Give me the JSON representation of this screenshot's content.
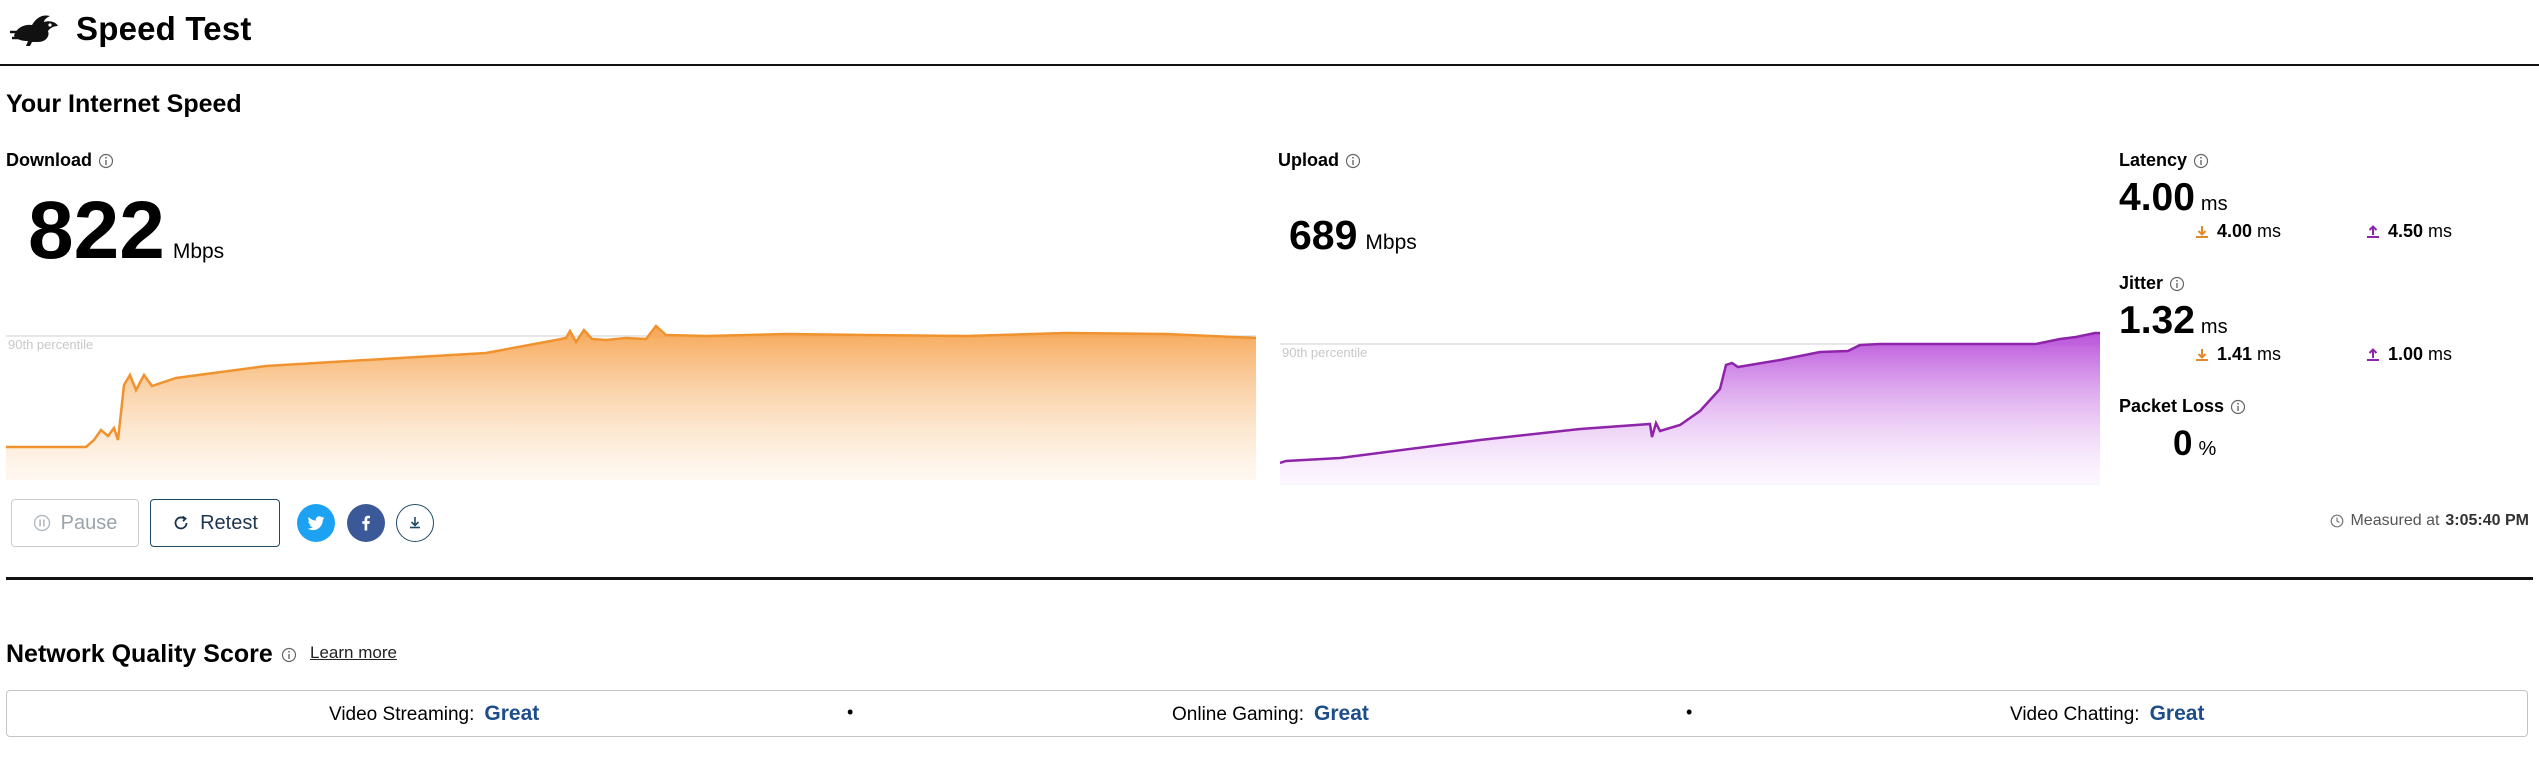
{
  "header": {
    "title": "Speed Test",
    "logo_icon": "rabbit-logo-icon"
  },
  "section_title": "Your Internet Speed",
  "download": {
    "label": "Download",
    "value": "822",
    "unit": "Mbps",
    "percentile_label": "90th percentile",
    "color": "#f0922e"
  },
  "upload": {
    "label": "Upload",
    "value": "689",
    "unit": "Mbps",
    "percentile_label": "90th percentile",
    "color": "#8e24aa"
  },
  "latency": {
    "label": "Latency",
    "value": "4.00",
    "unit": "ms",
    "down_value": "4.00",
    "down_unit": "ms",
    "up_value": "4.50",
    "up_unit": "ms"
  },
  "jitter": {
    "label": "Jitter",
    "value": "1.32",
    "unit": "ms",
    "down_value": "1.41",
    "down_unit": "ms",
    "up_value": "1.00",
    "up_unit": "ms"
  },
  "packet_loss": {
    "label": "Packet Loss",
    "value": "0",
    "unit": "%"
  },
  "controls": {
    "pause_label": "Pause",
    "retest_label": "Retest"
  },
  "measured": {
    "prefix": "Measured at",
    "time": "3:05:40 PM"
  },
  "network_quality": {
    "title": "Network Quality Score",
    "learn_more": "Learn more",
    "items": [
      {
        "label": "Video Streaming:",
        "value": "Great"
      },
      {
        "label": "Online Gaming:",
        "value": "Great"
      },
      {
        "label": "Video Chatting:",
        "value": "Great"
      }
    ],
    "separator": "•"
  },
  "colors": {
    "twitter": "#1da1f2",
    "facebook": "#3b5998",
    "quality": "#1d4e89"
  }
}
